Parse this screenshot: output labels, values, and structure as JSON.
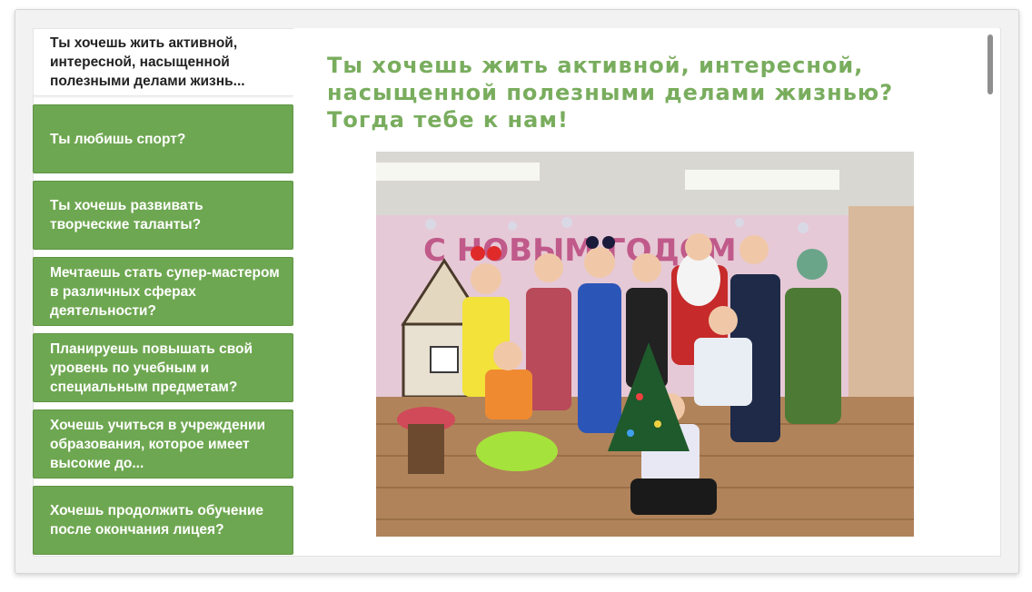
{
  "tabs": [
    {
      "label": "Ты хочешь жить активной, интересной, насыщенной полезными делами жизнь...",
      "active": true
    },
    {
      "label": "Ты любишь спорт?"
    },
    {
      "label": "Ты хочешь развивать творческие таланты?"
    },
    {
      "label": "Мечтаешь стать супер-мастером в различных сферах деятельности?"
    },
    {
      "label": "Планируешь повышать свой уровень по учебным и специальным предметам?"
    },
    {
      "label": "Хочешь учиться в учреждении образования, которое имеет высокие до..."
    },
    {
      "label": "Хочешь продолжить обучение после окончания лицея?"
    }
  ],
  "content": {
    "heading": "Ты хочешь жить активной, интересной, насыщенной полезными делами жизнью? Тогда тебе к нам!",
    "photo_banner_text": "С НОВЫМ ГОДОМ"
  },
  "colors": {
    "accent_green": "#6ea751",
    "heading_green": "#79ad5e"
  }
}
